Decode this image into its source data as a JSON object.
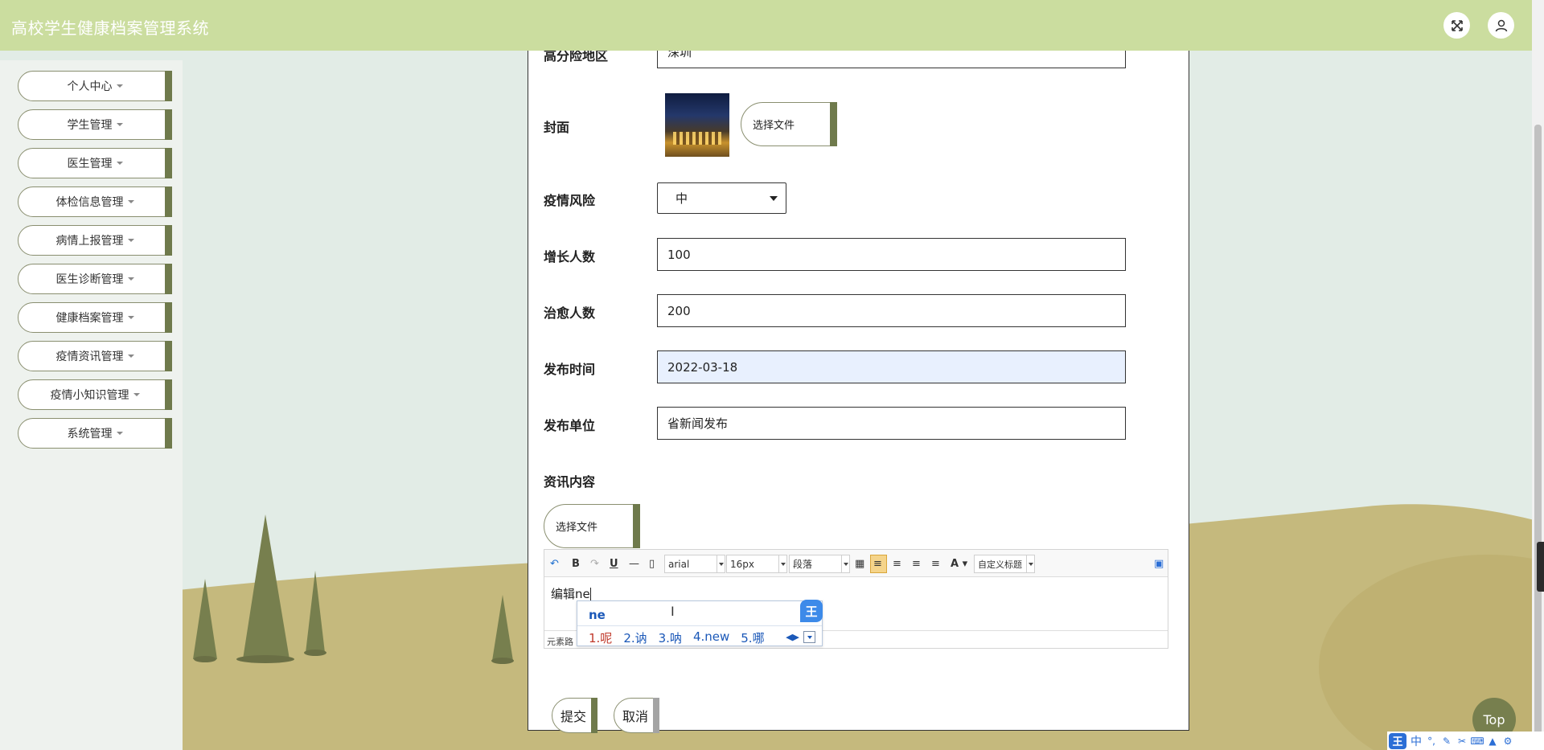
{
  "header": {
    "title": "高校学生健康档案管理系统",
    "fullscreen_icon": "fullscreen-icon",
    "user_icon": "user-icon"
  },
  "sidebar": {
    "items": [
      {
        "label": "个人中心"
      },
      {
        "label": "学生管理"
      },
      {
        "label": "医生管理"
      },
      {
        "label": "体检信息管理"
      },
      {
        "label": "病情上报管理"
      },
      {
        "label": "医生诊断管理"
      },
      {
        "label": "健康档案管理"
      },
      {
        "label": "疫情资讯管理"
      },
      {
        "label": "疫情小知识管理"
      },
      {
        "label": "系统管理"
      }
    ]
  },
  "form": {
    "high_risk_area": {
      "label": "高分险地区",
      "value": "深圳"
    },
    "cover": {
      "label": "封面",
      "file_button": "选择文件"
    },
    "risk": {
      "label": "疫情风险",
      "value": "中"
    },
    "growth": {
      "label": "增长人数",
      "value": "100"
    },
    "cured": {
      "label": "治愈人数",
      "value": "200"
    },
    "publish_time": {
      "label": "发布时间",
      "value": "2022-03-18"
    },
    "publisher": {
      "label": "发布单位",
      "value": "省新闻发布"
    },
    "content": {
      "label": "资讯内容",
      "file_button": "选择文件"
    }
  },
  "editor": {
    "font_family": "arial",
    "font_size": "16px",
    "paragraph": "段落",
    "custom_title": "自定义标题",
    "body_text": "编辑ne",
    "footer_text": "元素路"
  },
  "ime": {
    "composition": "ne",
    "candidates": [
      "1.呢",
      "2.讷",
      "3.呐",
      "4.new",
      "5.哪"
    ],
    "badge": "王",
    "status_bar": {
      "logo": "王",
      "lang": "中"
    }
  },
  "actions": {
    "submit": "提交",
    "cancel": "取消"
  },
  "back_to_top": "Top"
}
